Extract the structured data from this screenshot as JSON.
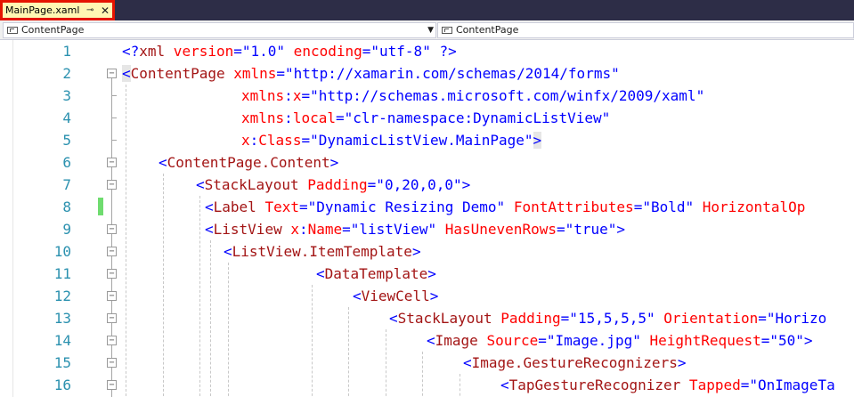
{
  "document_tab": {
    "title": "MainPage.xaml",
    "pin_icon": "pin-icon",
    "close_icon": "close-icon"
  },
  "navigation": {
    "left_dropdown": "ContentPage",
    "right_dropdown": "ContentPage"
  },
  "colors": {
    "titlebar": "#2d2d47",
    "tab_highlight": "#e51400",
    "line_number": "#2b91af",
    "xml_delimiter": "#0000ff",
    "xml_element": "#a31515",
    "xml_attribute": "#ff0000",
    "xml_value": "#0000ff",
    "change_marker": "#6fdc6f"
  },
  "editor": {
    "line_numbers": [
      "1",
      "2",
      "3",
      "4",
      "5",
      "6",
      "7",
      "8",
      "9",
      "10",
      "11",
      "12",
      "13",
      "14",
      "15",
      "16"
    ],
    "lines": [
      [
        [
          "d",
          "<?"
        ],
        [
          "e",
          "xml"
        ],
        [
          "a",
          " version"
        ],
        [
          "d",
          "=\""
        ],
        [
          "v",
          "1.0"
        ],
        [
          "d",
          "\""
        ],
        [
          "a",
          " encoding"
        ],
        [
          "d",
          "=\""
        ],
        [
          "v",
          "utf-8"
        ],
        [
          "d",
          "\""
        ],
        [
          "d",
          " ?>"
        ]
      ],
      [
        [
          "d",
          "<"
        ],
        [
          "e",
          "ContentPage"
        ],
        [
          "a",
          " xmlns"
        ],
        [
          "d",
          "=\""
        ],
        [
          "v",
          "http://xamarin.com/schemas/2014/forms"
        ],
        [
          "d",
          "\""
        ]
      ],
      [
        [
          "a",
          "xmlns"
        ],
        [
          "d",
          ":"
        ],
        [
          "a",
          "x"
        ],
        [
          "d",
          "=\""
        ],
        [
          "v",
          "http://schemas.microsoft.com/winfx/2009/xaml"
        ],
        [
          "d",
          "\""
        ]
      ],
      [
        [
          "a",
          "xmlns"
        ],
        [
          "d",
          ":"
        ],
        [
          "a",
          "local"
        ],
        [
          "d",
          "=\""
        ],
        [
          "v",
          "clr-namespace:DynamicListView"
        ],
        [
          "d",
          "\""
        ]
      ],
      [
        [
          "a",
          "x"
        ],
        [
          "d",
          ":"
        ],
        [
          "a",
          "Class"
        ],
        [
          "d",
          "=\""
        ],
        [
          "v",
          "DynamicListView.MainPage"
        ],
        [
          "d",
          "\""
        ],
        [
          "d",
          ">"
        ]
      ],
      [
        [
          "d",
          "<"
        ],
        [
          "e",
          "ContentPage.Content"
        ],
        [
          "d",
          ">"
        ]
      ],
      [
        [
          "d",
          "<"
        ],
        [
          "e",
          "StackLayout"
        ],
        [
          "a",
          " Padding"
        ],
        [
          "d",
          "=\""
        ],
        [
          "v",
          "0,20,0,0"
        ],
        [
          "d",
          "\""
        ],
        [
          "d",
          ">"
        ]
      ],
      [
        [
          "d",
          "<"
        ],
        [
          "e",
          "Label"
        ],
        [
          "a",
          " Text"
        ],
        [
          "d",
          "=\""
        ],
        [
          "v",
          "Dynamic Resizing Demo"
        ],
        [
          "d",
          "\""
        ],
        [
          "a",
          " FontAttributes"
        ],
        [
          "d",
          "=\""
        ],
        [
          "v",
          "Bold"
        ],
        [
          "d",
          "\""
        ],
        [
          "a",
          " HorizontalOp"
        ]
      ],
      [
        [
          "d",
          "<"
        ],
        [
          "e",
          "ListView"
        ],
        [
          "a",
          " x"
        ],
        [
          "d",
          ":"
        ],
        [
          "a",
          "Name"
        ],
        [
          "d",
          "=\""
        ],
        [
          "v",
          "listView"
        ],
        [
          "d",
          "\""
        ],
        [
          "a",
          " HasUnevenRows"
        ],
        [
          "d",
          "=\""
        ],
        [
          "v",
          "true"
        ],
        [
          "d",
          "\""
        ],
        [
          "d",
          ">"
        ]
      ],
      [
        [
          "d",
          "<"
        ],
        [
          "e",
          "ListView.ItemTemplate"
        ],
        [
          "d",
          ">"
        ]
      ],
      [
        [
          "d",
          "<"
        ],
        [
          "e",
          "DataTemplate"
        ],
        [
          "d",
          ">"
        ]
      ],
      [
        [
          "d",
          "<"
        ],
        [
          "e",
          "ViewCell"
        ],
        [
          "d",
          ">"
        ]
      ],
      [
        [
          "d",
          "<"
        ],
        [
          "e",
          "StackLayout"
        ],
        [
          "a",
          " Padding"
        ],
        [
          "d",
          "=\""
        ],
        [
          "v",
          "15,5,5,5"
        ],
        [
          "d",
          "\""
        ],
        [
          "a",
          " Orientation"
        ],
        [
          "d",
          "=\""
        ],
        [
          "v",
          "Horizo"
        ]
      ],
      [
        [
          "d",
          "<"
        ],
        [
          "e",
          "Image"
        ],
        [
          "a",
          " Source"
        ],
        [
          "d",
          "=\""
        ],
        [
          "v",
          "Image.jpg"
        ],
        [
          "d",
          "\""
        ],
        [
          "a",
          " HeightRequest"
        ],
        [
          "d",
          "=\""
        ],
        [
          "v",
          "50"
        ],
        [
          "d",
          "\""
        ],
        [
          "d",
          ">"
        ]
      ],
      [
        [
          "d",
          "<"
        ],
        [
          "e",
          "Image.GestureRecognizers"
        ],
        [
          "d",
          ">"
        ]
      ],
      [
        [
          "d",
          "<"
        ],
        [
          "e",
          "TapGestureRecognizer"
        ],
        [
          "a",
          " Tapped"
        ],
        [
          "d",
          "=\""
        ],
        [
          "v",
          "OnImageTa"
        ]
      ]
    ]
  }
}
